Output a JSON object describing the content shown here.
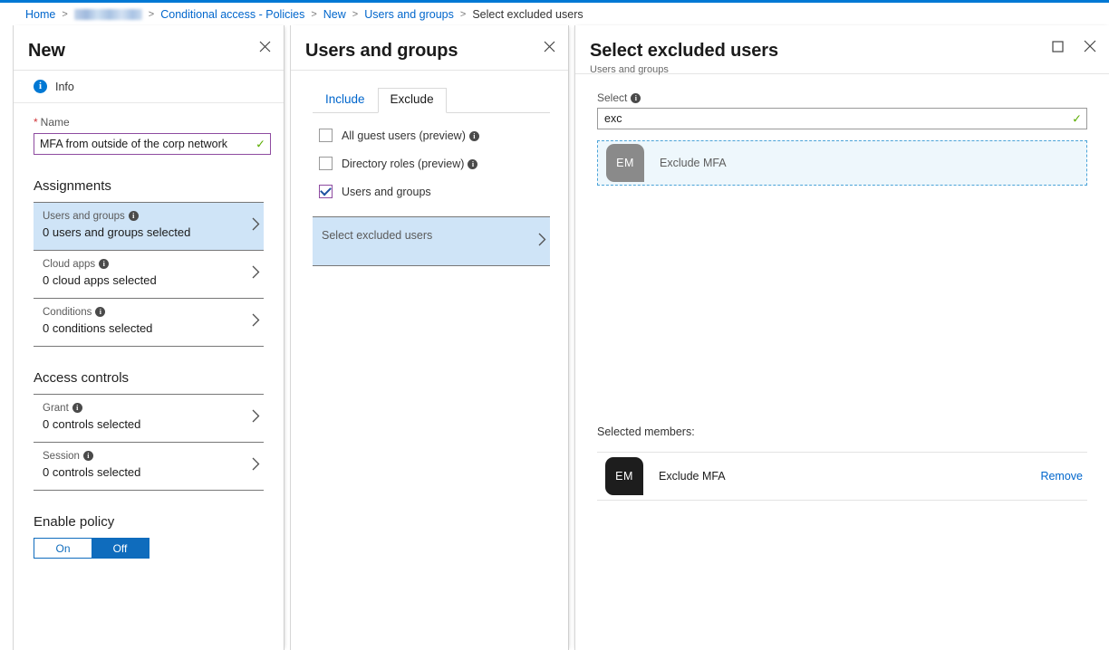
{
  "breadcrumb": {
    "items": [
      {
        "label": "Home",
        "type": "link"
      },
      {
        "label": "",
        "type": "redacted"
      },
      {
        "label": "Conditional access - Policies",
        "type": "link"
      },
      {
        "label": "New",
        "type": "link"
      },
      {
        "label": "Users and groups",
        "type": "link"
      },
      {
        "label": "Select excluded users",
        "type": "current"
      }
    ],
    "separator": ">"
  },
  "colors": {
    "accent": "#0078d4",
    "link": "#0066cc",
    "selected_row": "#cfe4f7",
    "validation_check": "#5aad00",
    "field_border_focus": "#8e4ba0",
    "toggle_on": "#0f6cbd",
    "required_star": "#d13438",
    "avatar_result": "#8a8a8a",
    "avatar_member": "#1d1d1d"
  },
  "new_blade": {
    "title": "New",
    "close_label": "Close",
    "info_label": "Info",
    "name_field": {
      "label": "Name",
      "required_marker": "*",
      "value": "MFA from outside of the corp network",
      "placeholder": "",
      "valid_glyph": "✓"
    },
    "assignments": {
      "title": "Assignments",
      "rows": [
        {
          "title": "Users and groups",
          "value": "0 users and groups selected",
          "selected": true
        },
        {
          "title": "Cloud apps",
          "value": "0 cloud apps selected",
          "selected": false
        },
        {
          "title": "Conditions",
          "value": "0 conditions selected",
          "selected": false
        }
      ]
    },
    "access_controls": {
      "title": "Access controls",
      "rows": [
        {
          "title": "Grant",
          "value": "0 controls selected"
        },
        {
          "title": "Session",
          "value": "0 controls selected"
        }
      ]
    },
    "enable_policy": {
      "title": "Enable policy",
      "on_label": "On",
      "off_label": "Off",
      "selected": "Off"
    }
  },
  "users_blade": {
    "title": "Users and groups",
    "close_label": "Close",
    "tabs": [
      {
        "label": "Include",
        "active": false
      },
      {
        "label": "Exclude",
        "active": true
      }
    ],
    "checkboxes": [
      {
        "label": "All guest users (preview)",
        "checked": false,
        "has_info": true
      },
      {
        "label": "Directory roles (preview)",
        "checked": false,
        "has_info": true
      },
      {
        "label": "Users and groups",
        "checked": true,
        "has_info": false
      }
    ],
    "select_excluded": {
      "label": "Select excluded users"
    }
  },
  "select_blade": {
    "title": "Select excluded users",
    "subtitle": "Users and groups",
    "maximize_label": "Maximize",
    "close_label": "Close",
    "select_field": {
      "label": "Select",
      "value": "exc",
      "placeholder": "",
      "valid_glyph": "✓"
    },
    "results": [
      {
        "initials": "EM",
        "name": "Exclude MFA",
        "highlighted": true
      }
    ],
    "selected_members_label": "Selected members:",
    "selected_members": [
      {
        "initials": "EM",
        "name": "Exclude MFA",
        "remove_label": "Remove"
      }
    ]
  }
}
